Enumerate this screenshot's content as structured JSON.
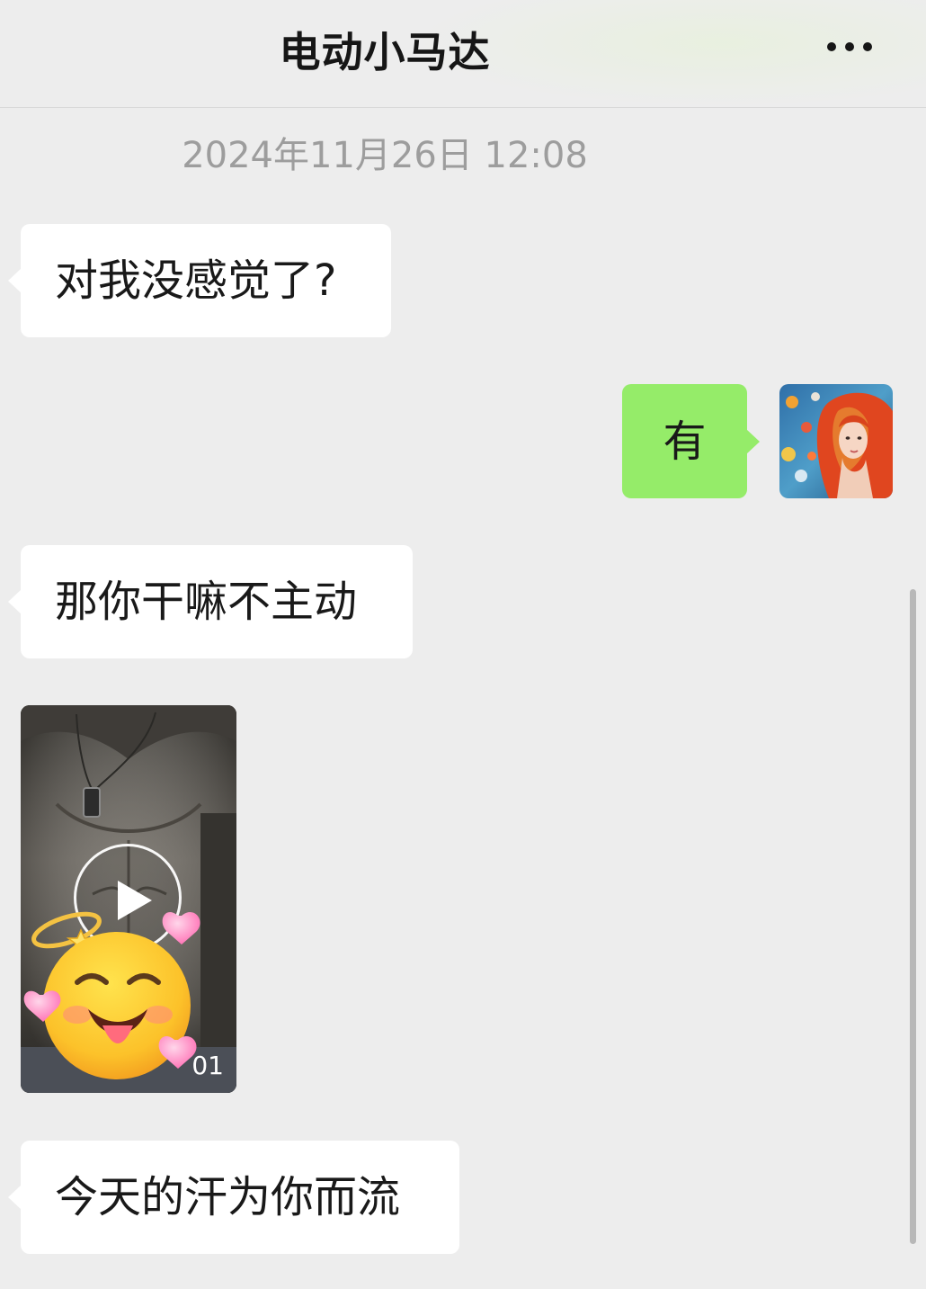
{
  "header": {
    "title": "电动小马达",
    "more_icon": "more-dots-icon"
  },
  "timestamp": "2024年11月26日 12:08",
  "messages": [
    {
      "side": "in",
      "type": "text",
      "text": "对我没感觉了?"
    },
    {
      "side": "out",
      "type": "text",
      "text": "有"
    },
    {
      "side": "in",
      "type": "text",
      "text": "那你干嘛不主动"
    },
    {
      "side": "in",
      "type": "video",
      "duration": "01",
      "sticker": "smiling-face-with-hearts-emoji"
    },
    {
      "side": "in",
      "type": "text",
      "text": "今天的汗为你而流"
    }
  ],
  "colors": {
    "background": "#ededed",
    "incoming_bubble": "#ffffff",
    "outgoing_bubble": "#95ec69",
    "timestamp_text": "#9d9d9d"
  }
}
